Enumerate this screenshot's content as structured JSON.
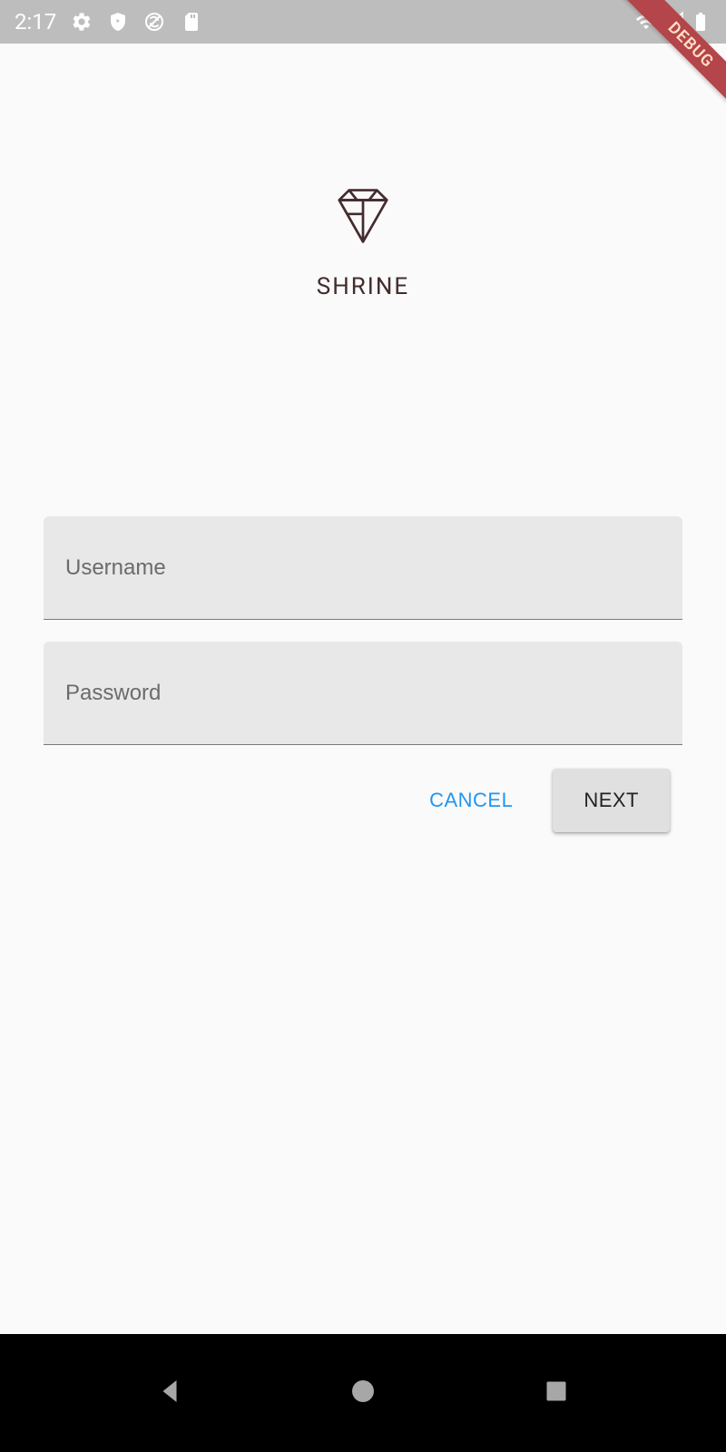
{
  "status_bar": {
    "time": "2:17"
  },
  "debug_banner": "DEBUG",
  "app": {
    "title": "SHRINE"
  },
  "form": {
    "username_placeholder": "Username",
    "password_placeholder": "Password"
  },
  "buttons": {
    "cancel_label": "CANCEL",
    "next_label": "NEXT"
  }
}
